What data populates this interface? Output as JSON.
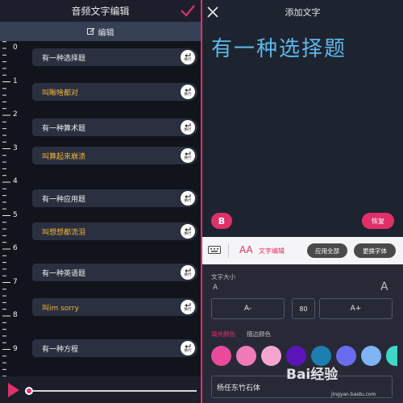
{
  "left": {
    "title": "音频文字编辑",
    "edit_label": "编辑",
    "ruler_ticks": [
      "0",
      "1",
      "2",
      "3",
      "4",
      "5",
      "6",
      "7",
      "8",
      "9"
    ],
    "wrap_label": "换行",
    "subtitles": [
      {
        "text": "有一种选择题",
        "color": "white"
      },
      {
        "text": "叫瞅啥都对",
        "color": "yellow"
      },
      {
        "text": "有一种算术题",
        "color": "white"
      },
      {
        "text": "叫算起来崩溃",
        "color": "yellow"
      },
      {
        "text": "有一种应用题",
        "color": "white"
      },
      {
        "text": "叫想想都流泪",
        "color": "yellow"
      },
      {
        "text": "有一种英语题",
        "color": "white"
      },
      {
        "text": "叫im sorry",
        "color": "yellow"
      },
      {
        "text": "有一种方程",
        "color": "white"
      }
    ]
  },
  "right": {
    "title": "添加文字",
    "preview_text": "有一种选择题",
    "bold_label": "B",
    "restore_label": "恢复",
    "text_edit_label": "文字编辑",
    "aa_label": "AA",
    "apply_all_label": "应用全部",
    "change_font_label": "更换字体",
    "size_label": "文字大小",
    "size_small_a": "A",
    "size_large_a": "A",
    "minus_label": "A-",
    "plus_label": "A+",
    "size_value": "80",
    "tab_fill_label": "填充颜色",
    "tab_stroke_label": "描边颜色",
    "swatches": [
      "#e94a9c",
      "#f07ab8",
      "#f5a6cf",
      "#5a14b8",
      "#1c7fb0",
      "#6a6cf0",
      "#7fb4f5",
      "#3fd6c8"
    ],
    "font_name": "杨任东竹石体"
  },
  "watermark": {
    "text": "Bai经验",
    "sub": "jingyan.baidu.com"
  },
  "colors": {
    "accent": "#e0306a",
    "subtitle_white": "#f0f0f0",
    "subtitle_yellow": "#f3b53a",
    "preview_text": "#5fb7e8"
  }
}
